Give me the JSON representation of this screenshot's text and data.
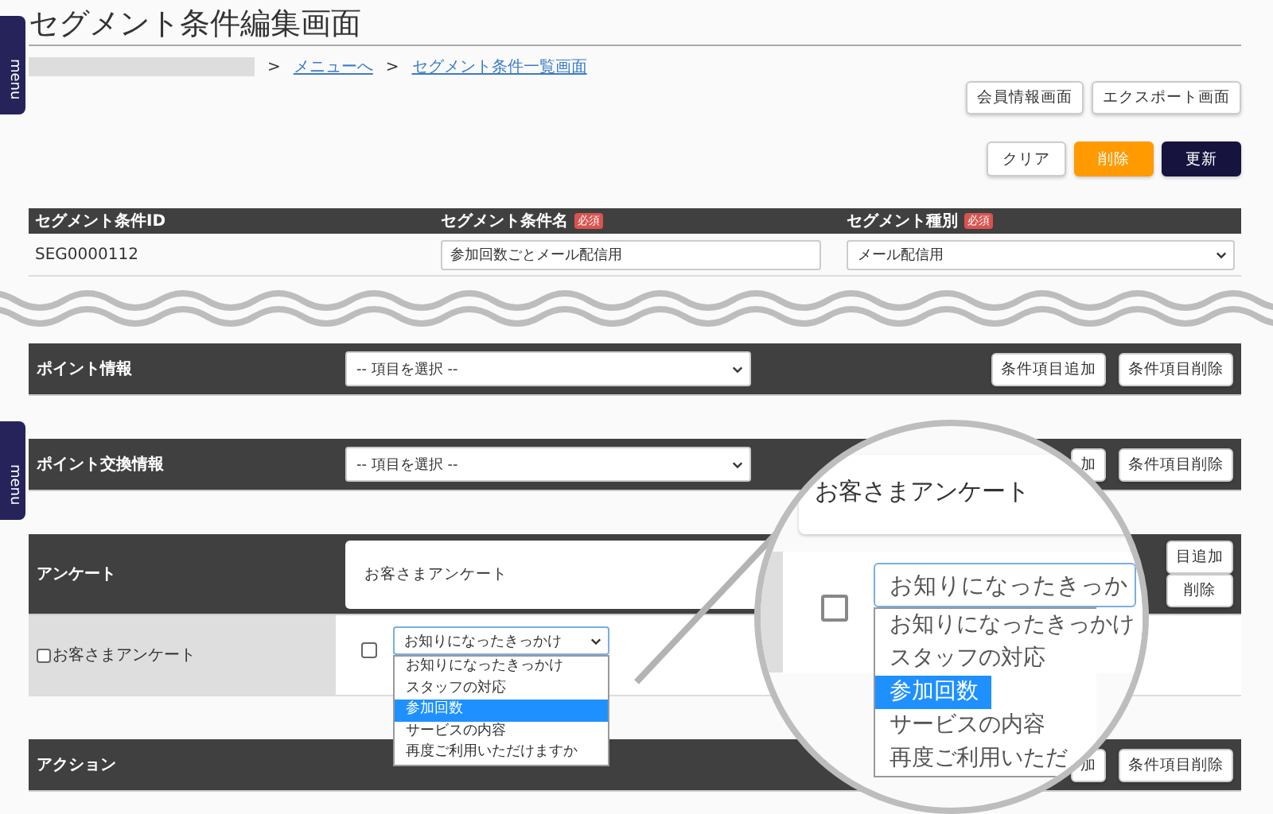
{
  "menu_tabs": [
    {
      "label": "menu"
    },
    {
      "label": "menu"
    }
  ],
  "title": "セグメント条件編集画面",
  "breadcrumb": [
    {
      "label": ">",
      "kind": "separator"
    },
    {
      "label": "メニューへ",
      "kind": "link"
    },
    {
      "label": ">",
      "kind": "separator"
    },
    {
      "label": "セグメント条件一覧画面",
      "kind": "link"
    }
  ],
  "nav_buttons": [
    "会員情報画面",
    "エクスポート画面"
  ],
  "action_buttons": [
    {
      "label": "クリア",
      "kind": "default"
    },
    {
      "label": "削除",
      "kind": "warning"
    },
    {
      "label": "更新",
      "kind": "primary"
    }
  ],
  "segment_table": {
    "columns": [
      {
        "label": "セグメント条件ID"
      },
      {
        "label": "セグメント条件名",
        "badge": "必須"
      },
      {
        "label": "セグメント種別",
        "badge": "必須"
      }
    ],
    "row": {
      "id": "SEG0000112",
      "name": "参加回数ごとメール配信用",
      "type": "メール配信用"
    }
  },
  "sections": [
    {
      "title": "ポイント情報",
      "kind": "select",
      "select": "-- 項目を選択 --",
      "buttons": [
        "条件項目追加",
        "条件項目削除"
      ]
    },
    {
      "title": "ポイント交換情報",
      "kind": "select",
      "select": "-- 項目を選択 --",
      "buttons": [
        "加",
        "条件項目削除"
      ]
    },
    {
      "title": "アンケート",
      "kind": "survey",
      "survey_name": "お客さまアンケート",
      "buttons": [
        "目追加",
        "削除"
      ],
      "question_row": {
        "label": "お客さまアンケート",
        "checked": false,
        "item_checked": false,
        "select": "お知りになったきっかけ",
        "options": [
          {
            "label": "お知りになったきっかけ",
            "selected": false
          },
          {
            "label": "スタッフの対応",
            "selected": false
          },
          {
            "label": "参加回数",
            "selected": true
          },
          {
            "label": "サービスの内容",
            "selected": false
          },
          {
            "label": "再度ご利用いただけますか",
            "selected": false
          }
        ]
      }
    },
    {
      "title": "アクション",
      "kind": "title",
      "buttons": [
        "加",
        "条件項目削除"
      ]
    }
  ],
  "magnifier": {
    "survey_name": "お客さまアンケート",
    "checked": false,
    "select": "お知りになったきっか",
    "options": [
      {
        "label": "お知りになったきっかけ",
        "selected": false
      },
      {
        "label": "スタッフの対応",
        "selected": false
      },
      {
        "label": "参加回数",
        "selected": true
      },
      {
        "label": "サービスの内容",
        "selected": false
      },
      {
        "label": "再度ご利用いただ",
        "selected": false
      }
    ]
  }
}
